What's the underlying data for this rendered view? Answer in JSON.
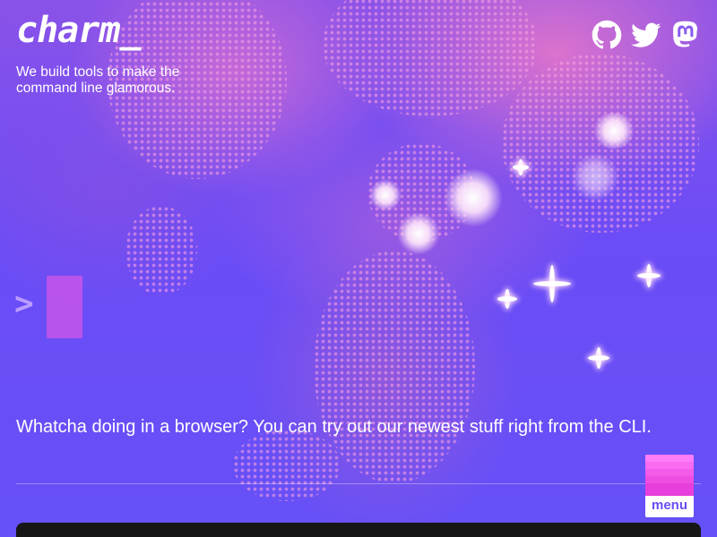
{
  "brand": {
    "logo_text": "charm_",
    "tagline": "We build tools to make the command line glamorous."
  },
  "socials": [
    {
      "icon": "github-icon",
      "label": "GitHub"
    },
    {
      "icon": "twitter-icon",
      "label": "Twitter"
    },
    {
      "icon": "mastodon-icon",
      "label": "Mastodon"
    }
  ],
  "terminal": {
    "prompt_symbol": ">"
  },
  "main": {
    "cli_message": "Whatcha doing in a browser? You can try out our newest stuff right from the CLI."
  },
  "menu": {
    "label": "menu"
  },
  "colors": {
    "background": "#6b4cf6",
    "accent_pink": "#f35be9",
    "menu_text": "#6b4cf5",
    "panel_dark": "#161616"
  }
}
